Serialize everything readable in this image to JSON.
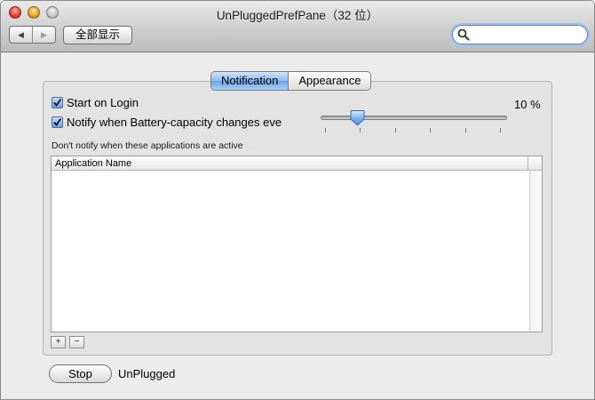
{
  "window": {
    "title": "UnPluggedPrefPane（32 位）"
  },
  "toolbar": {
    "back_label": "◀",
    "forward_label": "▶",
    "show_all_label": "全部显示",
    "search_value": "",
    "search_placeholder": ""
  },
  "tabs": [
    {
      "label": "Notification",
      "selected": true
    },
    {
      "label": "Appearance",
      "selected": false
    }
  ],
  "options": {
    "start_on_login": {
      "label": "Start on Login",
      "checked": true
    },
    "notify_battery": {
      "label": "Notify when Battery-capacity changes eve",
      "checked": true
    }
  },
  "slider": {
    "value_text": "10 %",
    "value": 10,
    "tick_count": 6
  },
  "apps": {
    "hint": "Don't notify when these applications are active",
    "column_header": "Application Name",
    "rows": [],
    "add_label": "+",
    "remove_label": "−"
  },
  "footer": {
    "stop_label": "Stop",
    "status_text": "UnPlugged"
  },
  "colors": {
    "accent": "#6aa5e7",
    "window_bg": "#ececec"
  }
}
